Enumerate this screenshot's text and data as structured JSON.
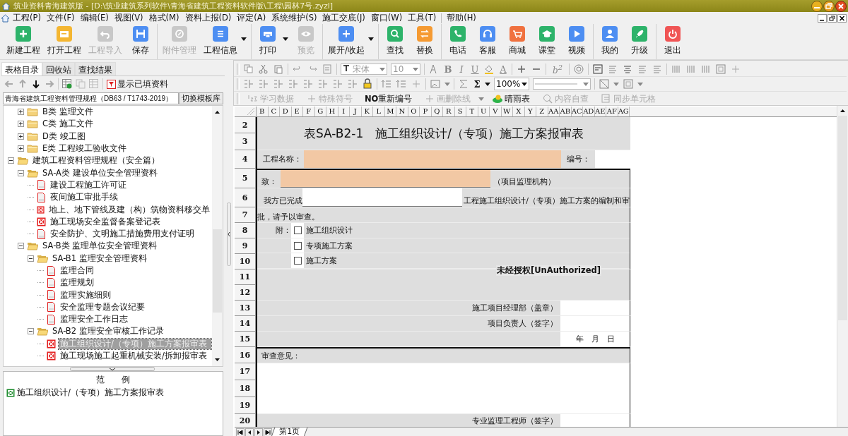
{
  "window": {
    "title": "筑业资料青海建筑版 - [D:\\筑业建筑系列软件\\青海省建筑工程资料软件版\\工程\\园林7号.zyzl]"
  },
  "menu": [
    "工程(P)",
    "文件(F)",
    "编辑(E)",
    "视图(V)",
    "格式(M)",
    "资料上报(D)",
    "评定(A)",
    "系统维护(S)",
    "施工交底(J)",
    "窗口(W)",
    "工具(T)",
    "帮助(H)"
  ],
  "toolbar": [
    [
      {
        "label": "新建工程",
        "color": "#2db36a",
        "disabled": false,
        "dropdown": false
      },
      {
        "label": "打开工程",
        "color": "#f4b632",
        "disabled": false,
        "dropdown": false
      },
      {
        "label": "工程导入",
        "color": "#c8c8c8",
        "disabled": true,
        "dropdown": false
      },
      {
        "label": "保存",
        "color": "#4d8ef2",
        "disabled": false,
        "dropdown": false
      }
    ],
    [
      {
        "label": "附件管理",
        "color": "#c8c8c8",
        "disabled": true,
        "dropdown": false
      },
      {
        "label": "工程信息",
        "color": "#4d8ef2",
        "disabled": false,
        "dropdown": true
      }
    ],
    [
      {
        "label": "打印",
        "color": "#4d8ef2",
        "disabled": false,
        "dropdown": true
      },
      {
        "label": "预览",
        "color": "#c8c8c8",
        "disabled": true,
        "dropdown": false
      }
    ],
    [
      {
        "label": "展开/收起",
        "color": "#4d8ef2",
        "disabled": false,
        "dropdown": true
      }
    ],
    [
      {
        "label": "查找",
        "color": "#2db36a",
        "disabled": false,
        "dropdown": false
      },
      {
        "label": "替换",
        "color": "#f59a32",
        "disabled": false,
        "dropdown": false
      }
    ],
    [
      {
        "label": "电话",
        "color": "#2db36a",
        "disabled": false,
        "dropdown": false
      },
      {
        "label": "客服",
        "color": "#4d8ef2",
        "disabled": false,
        "dropdown": false
      },
      {
        "label": "商城",
        "color": "#f0713f",
        "disabled": false,
        "dropdown": false
      },
      {
        "label": "课堂",
        "color": "#2db36a",
        "disabled": false,
        "dropdown": false
      },
      {
        "label": "视频",
        "color": "#4d8ef2",
        "disabled": false,
        "dropdown": false
      }
    ],
    [
      {
        "label": "我的",
        "color": "#4d8ef2",
        "disabled": false,
        "dropdown": false
      },
      {
        "label": "升级",
        "color": "#2db36a",
        "disabled": false,
        "dropdown": false
      }
    ],
    [
      {
        "label": "退出",
        "color": "#f05555",
        "disabled": false,
        "dropdown": false
      }
    ]
  ],
  "left_panel": {
    "tabs": [
      {
        "label": "表格目录",
        "selected": true
      },
      {
        "label": "回收站",
        "selected": false
      },
      {
        "label": "查找结果",
        "selected": false
      }
    ],
    "nav_buttons": [
      {
        "disabled": true
      },
      {
        "disabled": true
      },
      {
        "disabled": false
      },
      {
        "disabled": true
      }
    ],
    "show_filled": "显示已填资料",
    "standard": "青海省建筑工程资料管理规程（DB63 / T1743-2019）",
    "switch_button": "切换模板库",
    "tree": [
      {
        "children": [
          {
            "label": "B类 监理文件",
            "kind": "folder",
            "expanded": false,
            "selected": false
          },
          {
            "label": "C类 施工文件",
            "kind": "folder",
            "expanded": false,
            "selected": false
          },
          {
            "label": "D类 竣工图",
            "kind": "folder",
            "expanded": false,
            "selected": false
          },
          {
            "label": "E类 工程竣工验收文件",
            "kind": "folder",
            "expanded": false,
            "selected": false
          }
        ]
      },
      {
        "label": "建筑工程资料管理规程（安全篇）",
        "kind": "folder",
        "expanded": true,
        "selected": false,
        "children": [
          {
            "label": "SA-A类 建设单位安全管理资料",
            "kind": "folder",
            "expanded": true,
            "selected": false,
            "children": [
              {
                "label": "建设工程施工许可证",
                "kind": "page",
                "selected": false
              },
              {
                "label": "夜间施工审批手续",
                "kind": "page",
                "selected": false
              },
              {
                "label": "地上、地下管线及建（构）筑物资料移交单",
                "kind": "marked",
                "selected": false
              },
              {
                "label": "施工现场安全监督备案登记表",
                "kind": "marked",
                "selected": false
              },
              {
                "label": "安全防护、文明施工措施费用支付证明",
                "kind": "page",
                "selected": false
              }
            ]
          },
          {
            "label": "SA-B类 监理单位安全管理资料",
            "kind": "folder",
            "expanded": true,
            "selected": false,
            "children": [
              {
                "label": "SA-B1 监理安全管理资料",
                "kind": "folder",
                "expanded": true,
                "selected": false,
                "children": [
                  {
                    "label": "监理合同",
                    "kind": "page",
                    "selected": false
                  },
                  {
                    "label": "监理规划",
                    "kind": "page",
                    "selected": false
                  },
                  {
                    "label": "监理实施细则",
                    "kind": "page",
                    "selected": false
                  },
                  {
                    "label": "安全监理专题会议纪要",
                    "kind": "page",
                    "selected": false
                  },
                  {
                    "label": "监理安全工作日志",
                    "kind": "page",
                    "selected": false
                  }
                ]
              },
              {
                "label": "SA-B2 监理安全审核工作记录",
                "kind": "folder",
                "expanded": true,
                "selected": false,
                "children": [
                  {
                    "label": "施工组织设计/（专项）施工方案报审表",
                    "kind": "marked",
                    "selected": true
                  },
                  {
                    "label": "施工现场施工起重机械安装/拆卸报审表",
                    "kind": "marked",
                    "selected": false
                  }
                ]
              }
            ]
          }
        ]
      }
    ],
    "legend": {
      "title": "范　　例",
      "items": [
        {
          "label": "施工组织设计/（专项）施工方案报审表",
          "color": "#1a8a2a"
        }
      ]
    }
  },
  "format_toolbar": {
    "font": "宋体",
    "size": "10",
    "style_buttons": [
      "B",
      "I",
      "U"
    ],
    "font_color": "A",
    "superscript": "b$^{2}$",
    "sum": "Σ",
    "zoom": "100%"
  },
  "sheet_toolbar": [
    {
      "label": "学习数据",
      "disabled": true,
      "dropdown": false
    },
    {
      "label": "特殊符号",
      "disabled": true,
      "dropdown": false
    },
    {
      "label": "**NO**重新编号",
      "disabled": false,
      "dropdown": false
    },
    {
      "label": "画删除线",
      "disabled": true,
      "dropdown": true
    },
    {
      "label": "晴雨表",
      "disabled": false,
      "dropdown": false
    },
    {
      "label": "内容自查",
      "disabled": true,
      "dropdown": false
    },
    {
      "label": "同步单元格",
      "disabled": true,
      "dropdown": false
    }
  ],
  "sheet": {
    "columns": [
      "B",
      "C",
      "D",
      "E",
      "F",
      "G",
      "H",
      "I",
      "J",
      "K",
      "L",
      "M",
      "N",
      "O",
      "P",
      "Q",
      "R",
      "S",
      "T",
      "U",
      "V",
      "W",
      "X",
      "Y",
      "Z",
      "AA",
      "AB",
      "AC",
      "AD",
      "AE",
      "AF",
      "AG"
    ],
    "watermark": "未经授权[UnAuthorized]",
    "blocks": [
      {
        "kind": "title",
        "numbers": [
          "2",
          "3"
        ],
        "text": "表SA-B2-1　施工组织设计/（专项）施工方案报审表"
      },
      {
        "kind": "project",
        "numbers": [
          "4"
        ],
        "label": "工程名称：",
        "highlight": true,
        "code_label": "编号："
      },
      {
        "kind": "addressee",
        "numbers": [
          "5"
        ],
        "label": "致：",
        "highlight": true,
        "suffix": "（项目监理机构）"
      },
      {
        "kind": "completed",
        "numbers": [
          "6"
        ],
        "prefix": "我方已完成",
        "highlight": false,
        "suffix": "工程施工组织设计/（专项）施工方案的编制和审"
      },
      {
        "kind": "text",
        "numbers": [
          "7"
        ],
        "text": "批，请予以审查。"
      },
      {
        "kind": "attachments",
        "numbers": [
          "8",
          "9",
          "10"
        ],
        "label": "附：",
        "items": [
          {
            "label": "施工组织设计",
            "checked": false
          },
          {
            "label": "专项施工方案",
            "checked": false
          },
          {
            "label": "施工方案",
            "checked": false
          }
        ]
      },
      {
        "kind": "empty",
        "numbers": [
          "11",
          "12"
        ]
      },
      {
        "kind": "signature",
        "numbers": [
          "13"
        ],
        "text": "施工项目经理部（盖章）"
      },
      {
        "kind": "signature",
        "numbers": [
          "14"
        ],
        "text": "项目负责人（签字）"
      },
      {
        "kind": "date",
        "numbers": [
          "15"
        ],
        "text": "年　月　日"
      },
      {
        "kind": "heading",
        "numbers": [
          "16"
        ],
        "text": "审查意见："
      },
      {
        "kind": "blank",
        "numbers": [
          "17",
          "18",
          "19"
        ]
      },
      {
        "kind": "signature",
        "numbers": [
          "20"
        ],
        "text": "专业监理工程师（签字）"
      }
    ]
  },
  "sheet_tabs": [
    {
      "label": "第1页",
      "selected": true
    }
  ]
}
